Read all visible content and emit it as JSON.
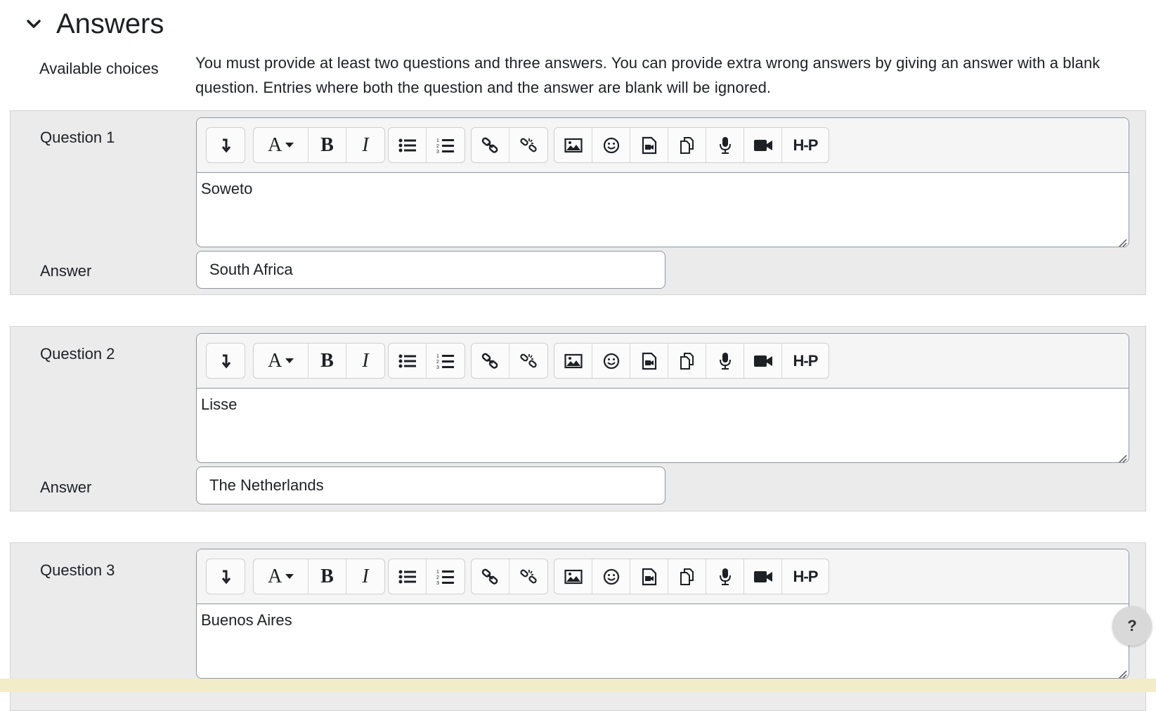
{
  "section": {
    "title": "Answers"
  },
  "available_choices": {
    "label": "Available choices",
    "text": "You must provide at least two questions and three answers. You can provide extra wrong answers by giving an answer with a blank question. Entries where both the question and the answer are blank will be ignored."
  },
  "toolbar": {
    "h5p_label": "H-P",
    "b_label": "B",
    "i_label": "I",
    "a_label": "A"
  },
  "questions": [
    {
      "label": "Question 1",
      "text": "Soweto",
      "answer_label": "Answer",
      "answer": "South Africa"
    },
    {
      "label": "Question 2",
      "text": "Lisse",
      "answer_label": "Answer",
      "answer": "The Netherlands"
    },
    {
      "label": "Question 3",
      "text": "Buenos Aires"
    }
  ],
  "help": {
    "label": "?"
  }
}
